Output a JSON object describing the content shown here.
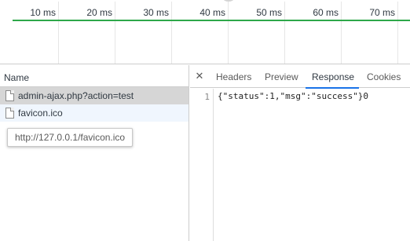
{
  "overview": {
    "ticks": [
      "10 ms",
      "20 ms",
      "30 ms",
      "40 ms",
      "50 ms",
      "60 ms",
      "70 ms"
    ]
  },
  "requests": {
    "column_header": "Name",
    "items": [
      {
        "name": "admin-ajax.php?action=test"
      },
      {
        "name": "favicon.ico"
      }
    ],
    "tooltip": "http://127.0.0.1/favicon.ico"
  },
  "details": {
    "close_glyph": "✕",
    "tabs": [
      "Headers",
      "Preview",
      "Response",
      "Cookies"
    ],
    "active_tab": "Response",
    "response": {
      "line_number": "1",
      "text": "{\"status\":1,\"msg\":\"success\"}0"
    }
  },
  "colors": {
    "waterfall_line": "#2ea84a",
    "active_tab_underline": "#1a73e8",
    "selected_row": "#d6d6d6"
  }
}
